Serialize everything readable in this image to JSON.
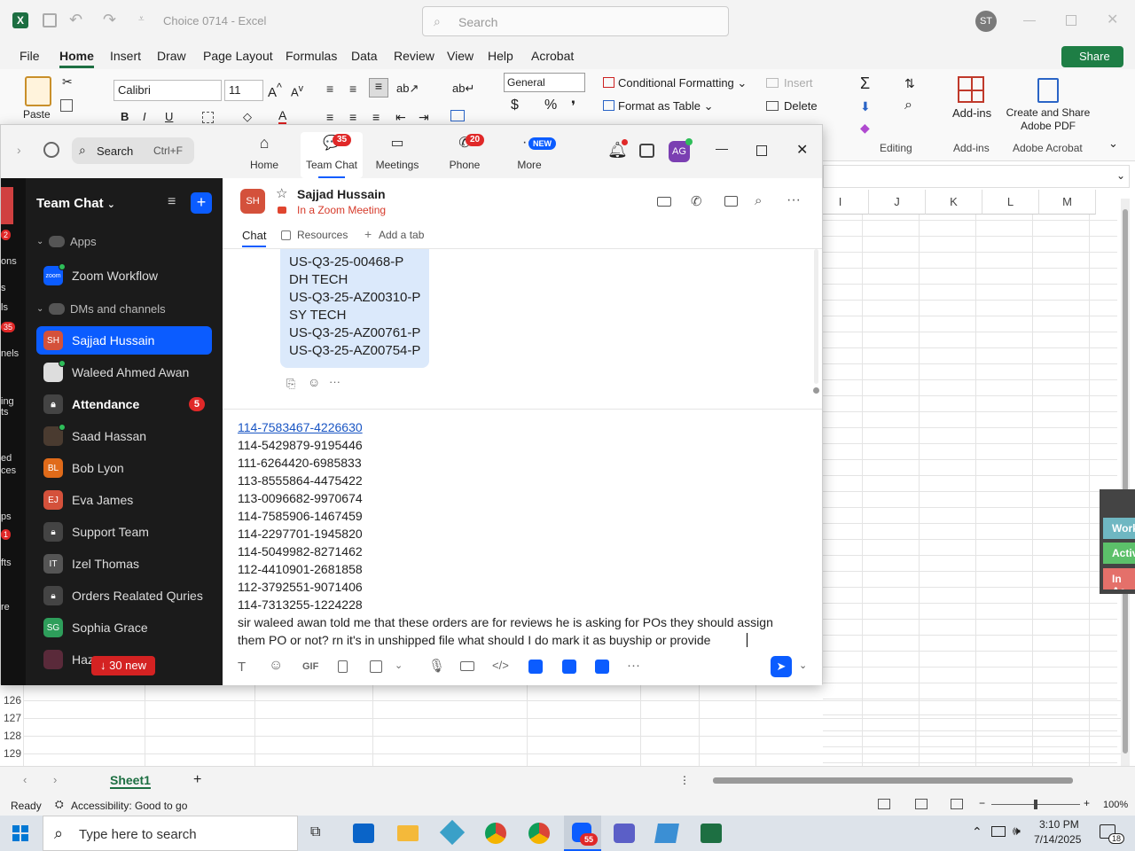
{
  "excel": {
    "title": "Choice 0714  -  Excel",
    "search_placeholder": "Search",
    "user_initials": "ST",
    "share_label": "Share",
    "menu": [
      "File",
      "Home",
      "Insert",
      "Draw",
      "Page Layout",
      "Formulas",
      "Data",
      "Review",
      "View",
      "Help",
      "Acrobat"
    ],
    "ribbon": {
      "paste": "Paste",
      "font_name": "Calibri",
      "font_size": "11",
      "number_format": "General",
      "conditional_formatting": "Conditional Formatting",
      "format_as_table": "Format as Table",
      "insert": "Insert",
      "delete": "Delete",
      "editing": "Editing",
      "addins": "Add-ins",
      "addins_group": "Add-ins",
      "create_share": "Create and Share Adobe PDF",
      "adobe_group": "Adobe Acrobat"
    },
    "columns": [
      "I",
      "J",
      "K",
      "L",
      "M"
    ],
    "rows": [
      "126",
      "127",
      "128",
      "129"
    ],
    "sheet_tab": "Sheet1",
    "status_ready": "Ready",
    "accessibility": "Accessibility: Good to go",
    "zoom_level": "100%",
    "side_tabs": [
      "Work",
      "Activ",
      "In Ac"
    ]
  },
  "zoom": {
    "search_label": "Search",
    "search_shortcut": "Ctrl+F",
    "tabs": [
      {
        "label": "Home"
      },
      {
        "label": "Team Chat",
        "badge": "35"
      },
      {
        "label": "Meetings"
      },
      {
        "label": "Phone",
        "badge": "20"
      },
      {
        "label": "More",
        "badge": "NEW"
      }
    ],
    "user_avatar": "AG",
    "sidebar": {
      "title": "Team Chat",
      "apps_header": "Apps",
      "zoom_workflow": "Zoom Workflow",
      "dms_header": "DMs and channels",
      "items": [
        {
          "label": "Sajjad Hussain",
          "initials": "SH"
        },
        {
          "label": "Waleed Ahmed Awan"
        },
        {
          "label": "Attendance",
          "badge": "5"
        },
        {
          "label": "Saad Hassan"
        },
        {
          "label": "Bob Lyon",
          "initials": "BL"
        },
        {
          "label": "Eva James",
          "initials": "EJ"
        },
        {
          "label": "Support Team"
        },
        {
          "label": "Izel Thomas",
          "initials": "IT"
        },
        {
          "label": "Orders Realated Quries"
        },
        {
          "label": "Sophia Grace",
          "initials": "SG"
        },
        {
          "label": "Haz"
        }
      ],
      "new_messages": "30 new",
      "left_strip_labels": [
        "ons",
        "s",
        "ls",
        "nels",
        "ing",
        "ts",
        "ed",
        "ces",
        "ps",
        "fts",
        "re"
      ],
      "left_strip_badges": [
        "2",
        "35",
        "1"
      ]
    },
    "chat_header": {
      "initials": "SH",
      "name": "Sajjad Hussain",
      "status": "In a Zoom Meeting",
      "tab_chat": "Chat",
      "tab_resources": "Resources",
      "tab_add": "Add a tab"
    },
    "bubble_lines": [
      "US-Q3-25-00468-P",
      "DH TECH",
      "US-Q3-25-AZ00310-P",
      "SY TECH",
      "US-Q3-25-AZ00761-P",
      "US-Q3-25-AZ00754-P"
    ],
    "compose": {
      "lines": [
        "114-7583467-4226630",
        "114-5429879-9195446",
        "111-6264420-6985833",
        "113-8555864-4475422",
        "113-0096682-9970674",
        "114-7585906-1467459",
        "114-2297701-1945820",
        "114-5049982-8271462",
        "112-4410901-2681858",
        "112-3792551-9071406",
        "114-7313255-1224228",
        "sir waleed awan told me that these orders are for reviews he is asking for POs they should assign",
        "them PO or not? rn it's in unshipped file what should I do mark it as buyship or provide"
      ],
      "gif": "GIF"
    }
  },
  "taskbar": {
    "search_placeholder": "Type here to search",
    "time": "3:10 PM",
    "date": "7/14/2025",
    "notification_count": "18",
    "zoom_badge": "55"
  }
}
